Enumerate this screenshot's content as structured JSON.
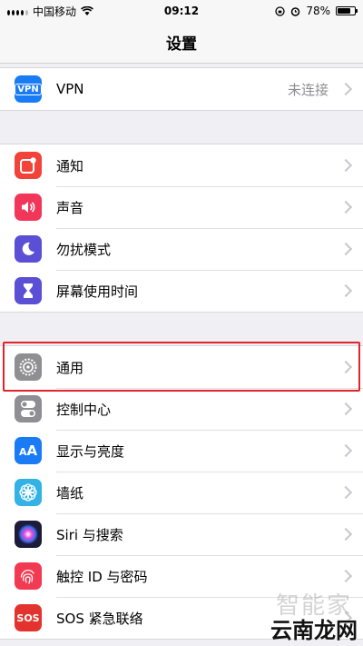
{
  "status": {
    "carrier": "中国移动",
    "time": "09:12",
    "battery": "78%",
    "battery_level": 0.78
  },
  "navbar": {
    "title": "设置"
  },
  "vpn_group": [
    {
      "id": "vpn",
      "label": "VPN",
      "value": "未连接",
      "icon": "vpn-icon",
      "color": "#1a7cf5"
    }
  ],
  "group2": [
    {
      "id": "notifications",
      "label": "通知",
      "icon": "notification-icon",
      "color": "#f2433a"
    },
    {
      "id": "sounds",
      "label": "声音",
      "icon": "speaker-icon",
      "color": "#f2365a"
    },
    {
      "id": "dnd",
      "label": "勿扰模式",
      "icon": "moon-icon",
      "color": "#5b4fd6"
    },
    {
      "id": "screen-time",
      "label": "屏幕使用时间",
      "icon": "hourglass-icon",
      "color": "#5b4fd6"
    }
  ],
  "group3": [
    {
      "id": "general",
      "label": "通用",
      "icon": "gear-icon",
      "color": "#8e8e93"
    },
    {
      "id": "control-center",
      "label": "控制中心",
      "icon": "toggle-icon",
      "color": "#8e8e93"
    },
    {
      "id": "display",
      "label": "显示与亮度",
      "icon": "text-size-icon",
      "color": "#1a7cf5"
    },
    {
      "id": "wallpaper",
      "label": "墙纸",
      "icon": "flower-icon",
      "color": "#33b2e6"
    },
    {
      "id": "siri",
      "label": "Siri 与搜索",
      "icon": "siri-icon",
      "color": "#1c1c3a"
    },
    {
      "id": "touch-id",
      "label": "触控 ID 与密码",
      "icon": "fingerprint-icon",
      "color": "#f23a52"
    },
    {
      "id": "sos",
      "label": "SOS 紧急联络",
      "icon": "sos-icon",
      "color": "#e3332e"
    }
  ],
  "watermark": {
    "text": "云南龙网",
    "brand": "智能家"
  }
}
